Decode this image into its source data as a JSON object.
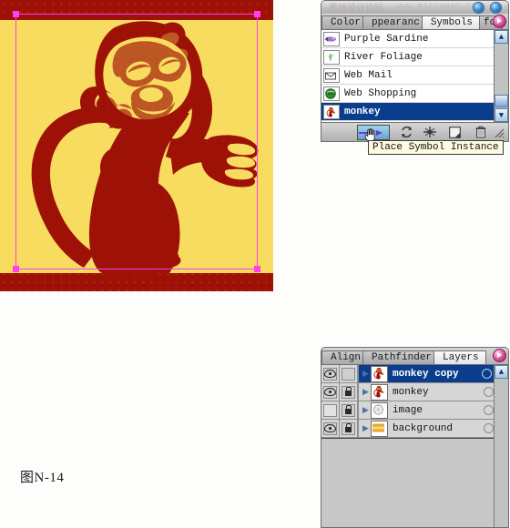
{
  "artwork": {
    "name": "monkey-illustration",
    "background_color": "#9e1106",
    "panel_color": "#f8dc60",
    "ink_color": "#9e1106",
    "selection_color": "#ff3ff0",
    "caption": "图N-14"
  },
  "symbols_panel": {
    "title": "Symbols",
    "watermark_cn": "思缘设计论坛",
    "watermark_url": "www.missyuan.com",
    "tabs": [
      {
        "label": "Color",
        "icon": "color-tab-icon",
        "active": false
      },
      {
        "label": "ppearanc",
        "icon": "appearance-tab-icon",
        "active": false
      },
      {
        "label": "Symbols",
        "icon": "symbols-tab-icon",
        "active": true
      },
      {
        "label": "fo",
        "icon": "info-tab-icon",
        "active": false
      }
    ],
    "items": [
      {
        "name": "Purple Sardine",
        "thumb": "purple-sardine-thumb",
        "selected": false
      },
      {
        "name": "River Foliage",
        "thumb": "river-foliage-thumb",
        "selected": false
      },
      {
        "name": "Web Mail",
        "thumb": "web-mail-thumb",
        "selected": false
      },
      {
        "name": "Web Shopping",
        "thumb": "web-shopping-thumb",
        "selected": false
      },
      {
        "name": "monkey",
        "thumb": "monkey-thumb",
        "selected": true
      }
    ],
    "toolbar": [
      {
        "name": "place-symbol-instance",
        "label": "Place Symbol Instance",
        "active": true
      },
      {
        "name": "replace-symbol",
        "label": "Replace Symbol",
        "active": false
      },
      {
        "name": "break-link-to-symbol",
        "label": "Break Link To Symbol",
        "active": false
      },
      {
        "name": "new-symbol",
        "label": "New Symbol",
        "active": false
      },
      {
        "name": "delete-symbol",
        "label": "Delete Symbol",
        "active": false
      }
    ],
    "tooltip": "Place Symbol Instance",
    "scroll": {
      "up_arrow": "▲",
      "down_arrow": "▼"
    }
  },
  "layers_panel": {
    "title": "Layers",
    "tabs": [
      {
        "label": "Align",
        "icon": "align-tab-icon",
        "active": false
      },
      {
        "label": "Pathfinder",
        "icon": "pathfinder-tab-icon",
        "active": false
      },
      {
        "label": "Layers",
        "icon": "layers-tab-icon",
        "active": true
      }
    ],
    "rows": [
      {
        "name": "monkey copy",
        "visible": true,
        "locked": false,
        "selected": true,
        "thumb": "monkey-layer-thumb",
        "selection_swatch": "#ff63e6"
      },
      {
        "name": "monkey",
        "visible": true,
        "locked": true,
        "selected": false,
        "thumb": "monkey-layer-thumb",
        "selection_swatch": ""
      },
      {
        "name": "image",
        "visible": false,
        "locked": true,
        "selected": false,
        "thumb": "image-layer-thumb",
        "selection_swatch": ""
      },
      {
        "name": "background",
        "visible": true,
        "locked": true,
        "selected": false,
        "thumb": "background-layer-thumb",
        "selection_swatch": ""
      }
    ]
  }
}
